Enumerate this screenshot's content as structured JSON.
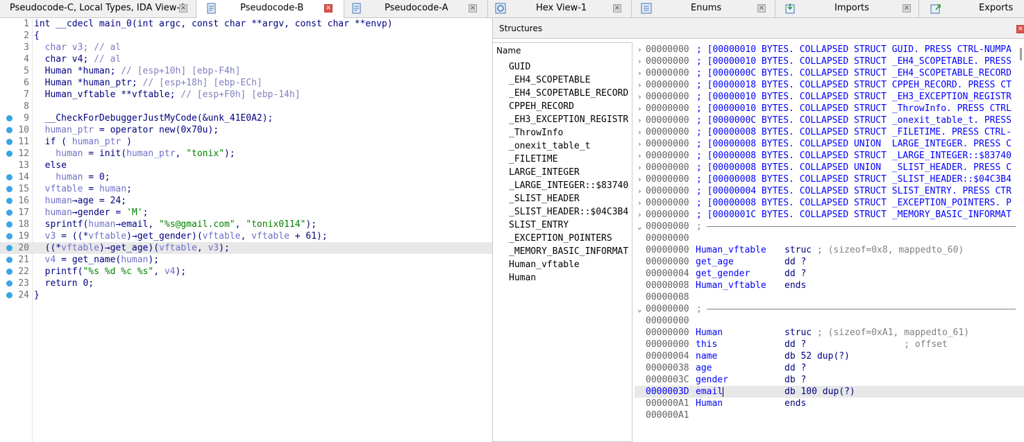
{
  "tabs": [
    {
      "label": "Pseudocode-C, Local Types, IDA View-A",
      "active": false,
      "close": "×"
    },
    {
      "label": "Pseudocode-B",
      "active": true,
      "close": "×"
    },
    {
      "label": "Pseudocode-A",
      "active": false,
      "close": "×"
    },
    {
      "label": "Hex View-1",
      "active": false,
      "close": "×"
    },
    {
      "label": "Enums",
      "active": false,
      "close": "×"
    },
    {
      "label": "Imports",
      "active": false,
      "close": "×"
    },
    {
      "label": "Exports",
      "active": false,
      "close": ""
    }
  ],
  "code": {
    "highlight_line": 20,
    "lines": [
      {
        "n": "1",
        "bp": false,
        "tokens": [
          [
            "p",
            "int __cdecl main_0(int argc, const char **argv, const char **envp)"
          ]
        ]
      },
      {
        "n": "2",
        "bp": false,
        "tokens": [
          [
            "p",
            "{"
          ]
        ]
      },
      {
        "n": "3",
        "bp": false,
        "tokens": [
          [
            "v",
            "  char v3; "
          ],
          [
            "c",
            "// al"
          ]
        ]
      },
      {
        "n": "4",
        "bp": false,
        "tokens": [
          [
            "p",
            "  char v4; "
          ],
          [
            "c",
            "// al"
          ]
        ]
      },
      {
        "n": "5",
        "bp": false,
        "tokens": [
          [
            "p",
            "  Human *human; "
          ],
          [
            "c",
            "// [esp+10h] [ebp-F4h]"
          ]
        ]
      },
      {
        "n": "6",
        "bp": false,
        "tokens": [
          [
            "p",
            "  Human *human_ptr; "
          ],
          [
            "c",
            "// [esp+18h] [ebp-ECh]"
          ]
        ]
      },
      {
        "n": "7",
        "bp": false,
        "tokens": [
          [
            "p",
            "  Human_vftable **vftable; "
          ],
          [
            "c",
            "// [esp+F0h] [ebp-14h]"
          ]
        ]
      },
      {
        "n": "8",
        "bp": false,
        "tokens": [
          [
            "p",
            ""
          ]
        ]
      },
      {
        "n": "9",
        "bp": true,
        "tokens": [
          [
            "p",
            "  __CheckForDebuggerJustMyCode(&unk_41E0A2);"
          ]
        ]
      },
      {
        "n": "10",
        "bp": true,
        "tokens": [
          [
            "v",
            "  human_ptr"
          ],
          [
            "p",
            " = operator new(0x70u);"
          ]
        ]
      },
      {
        "n": "11",
        "bp": true,
        "tokens": [
          [
            "p",
            "  if ( "
          ],
          [
            "v",
            "human_ptr"
          ],
          [
            "p",
            " )"
          ]
        ]
      },
      {
        "n": "12",
        "bp": true,
        "tokens": [
          [
            "v",
            "    human"
          ],
          [
            "p",
            " = init("
          ],
          [
            "v",
            "human_ptr"
          ],
          [
            "p",
            ", "
          ],
          [
            "s",
            "\"tonix\""
          ],
          [
            "p",
            ");"
          ]
        ]
      },
      {
        "n": "13",
        "bp": false,
        "tokens": [
          [
            "p",
            "  else"
          ]
        ]
      },
      {
        "n": "14",
        "bp": true,
        "tokens": [
          [
            "v",
            "    human"
          ],
          [
            "p",
            " = 0;"
          ]
        ]
      },
      {
        "n": "15",
        "bp": true,
        "tokens": [
          [
            "v",
            "  vftable"
          ],
          [
            "p",
            " = "
          ],
          [
            "v",
            "human"
          ],
          [
            "p",
            ";"
          ]
        ]
      },
      {
        "n": "16",
        "bp": true,
        "tokens": [
          [
            "v",
            "  human"
          ],
          [
            "p",
            "→age = 24;"
          ]
        ]
      },
      {
        "n": "17",
        "bp": true,
        "tokens": [
          [
            "v",
            "  human"
          ],
          [
            "p",
            "→gender = "
          ],
          [
            "s",
            "'M'"
          ],
          [
            "p",
            ";"
          ]
        ]
      },
      {
        "n": "18",
        "bp": true,
        "tokens": [
          [
            "p",
            "  sprintf("
          ],
          [
            "v",
            "human"
          ],
          [
            "p",
            "→email, "
          ],
          [
            "s",
            "\"%s@gmail.com\""
          ],
          [
            "p",
            ", "
          ],
          [
            "s",
            "\"tonix0114\""
          ],
          [
            "p",
            ");"
          ]
        ]
      },
      {
        "n": "19",
        "bp": true,
        "tokens": [
          [
            "v",
            "  v3"
          ],
          [
            "p",
            " = ((*"
          ],
          [
            "v",
            "vftable"
          ],
          [
            "p",
            ")→get_gender)("
          ],
          [
            "v",
            "vftable"
          ],
          [
            "p",
            ", "
          ],
          [
            "v",
            "vftable"
          ],
          [
            "p",
            " + 61);"
          ]
        ]
      },
      {
        "n": "20",
        "bp": true,
        "tokens": [
          [
            "p",
            "  ((*"
          ],
          [
            "v",
            "vftable"
          ],
          [
            "p",
            ")→get_age)("
          ],
          [
            "v",
            "vftable"
          ],
          [
            "p",
            ", "
          ],
          [
            "v",
            "v3"
          ],
          [
            "p",
            ");"
          ]
        ]
      },
      {
        "n": "21",
        "bp": true,
        "tokens": [
          [
            "v",
            "  v4"
          ],
          [
            "p",
            " = get_name("
          ],
          [
            "v",
            "human"
          ],
          [
            "p",
            ");"
          ]
        ]
      },
      {
        "n": "22",
        "bp": true,
        "tokens": [
          [
            "p",
            "  printf("
          ],
          [
            "s",
            "\"%s %d %c %s\""
          ],
          [
            "p",
            ", "
          ],
          [
            "v",
            "v4"
          ],
          [
            "p",
            ");"
          ]
        ]
      },
      {
        "n": "23",
        "bp": true,
        "tokens": [
          [
            "p",
            "  return 0;"
          ]
        ]
      },
      {
        "n": "24",
        "bp": true,
        "tokens": [
          [
            "p",
            "}"
          ]
        ]
      }
    ]
  },
  "structures": {
    "title": "Structures",
    "close": "×",
    "name_header": "Name",
    "names": [
      "GUID",
      "_EH4_SCOPETABLE",
      "_EH4_SCOPETABLE_RECORD",
      "CPPEH_RECORD",
      "_EH3_EXCEPTION_REGISTR",
      "_ThrowInfo",
      "_onexit_table_t",
      "_FILETIME",
      "LARGE_INTEGER",
      "_LARGE_INTEGER::$83740",
      "_SLIST_HEADER",
      "_SLIST_HEADER::$04C3B4",
      "SLIST_ENTRY",
      "_EXCEPTION_POINTERS",
      "_MEMORY_BASIC_INFORMAT",
      "Human_vftable",
      "Human"
    ],
    "collapsed": [
      {
        "addr": "00000000",
        "text": "; [00000010 BYTES. COLLAPSED STRUCT GUID. PRESS CTRL-NUMPA"
      },
      {
        "addr": "00000000",
        "text": "; [00000010 BYTES. COLLAPSED STRUCT _EH4_SCOPETABLE. PRESS"
      },
      {
        "addr": "00000000",
        "text": "; [0000000C BYTES. COLLAPSED STRUCT _EH4_SCOPETABLE_RECORD"
      },
      {
        "addr": "00000000",
        "text": "; [00000018 BYTES. COLLAPSED STRUCT CPPEH_RECORD. PRESS CT"
      },
      {
        "addr": "00000000",
        "text": "; [00000010 BYTES. COLLAPSED STRUCT _EH3_EXCEPTION_REGISTR"
      },
      {
        "addr": "00000000",
        "text": "; [00000010 BYTES. COLLAPSED STRUCT _ThrowInfo. PRESS CTRL"
      },
      {
        "addr": "00000000",
        "text": "; [0000000C BYTES. COLLAPSED STRUCT _onexit_table_t. PRESS"
      },
      {
        "addr": "00000000",
        "text": "; [00000008 BYTES. COLLAPSED STRUCT _FILETIME. PRESS CTRL-"
      },
      {
        "addr": "00000000",
        "text": "; [00000008 BYTES. COLLAPSED UNION  LARGE_INTEGER. PRESS C"
      },
      {
        "addr": "00000000",
        "text": "; [00000008 BYTES. COLLAPSED STRUCT _LARGE_INTEGER::$83740"
      },
      {
        "addr": "00000000",
        "text": "; [00000008 BYTES. COLLAPSED UNION  _SLIST_HEADER. PRESS C"
      },
      {
        "addr": "00000000",
        "text": "; [00000008 BYTES. COLLAPSED STRUCT _SLIST_HEADER::$04C3B4"
      },
      {
        "addr": "00000000",
        "text": "; [00000004 BYTES. COLLAPSED STRUCT SLIST_ENTRY. PRESS CTR"
      },
      {
        "addr": "00000000",
        "text": "; [00000008 BYTES. COLLAPSED STRUCT _EXCEPTION_POINTERS. P"
      },
      {
        "addr": "00000000",
        "text": "; [0000001C BYTES. COLLAPSED STRUCT _MEMORY_BASIC_INFORMAT"
      }
    ],
    "vftable_block": {
      "sep_addr": "00000000",
      "sep_semi": ";",
      "blank_addr": "00000000",
      "rows": [
        {
          "addr": "00000000",
          "field": "Human_vftable",
          "decl": "struc",
          "comment": "; (sizeof=0x8, mappedto_60)"
        },
        {
          "addr": "00000000",
          "field": "get_age",
          "decl": "dd ?",
          "comment": ""
        },
        {
          "addr": "00000004",
          "field": "get_gender",
          "decl": "dd ?",
          "comment": ""
        },
        {
          "addr": "00000008",
          "field": "Human_vftable",
          "decl": "ends",
          "comment": ""
        }
      ],
      "tail_addr": "00000008"
    },
    "human_block": {
      "sep_addr": "00000000",
      "sep_semi": ";",
      "blank_addr": "00000000",
      "rows": [
        {
          "addr": "00000000",
          "field": "Human",
          "decl": "struc",
          "comment": "; (sizeof=0xA1, mappedto_61)",
          "hl": false
        },
        {
          "addr": "00000000",
          "field": "this",
          "decl": "dd ?",
          "comment": "                 ; offset",
          "hl": false
        },
        {
          "addr": "00000004",
          "field": "name",
          "decl": "db 52 dup(?)",
          "comment": "",
          "hl": false
        },
        {
          "addr": "00000038",
          "field": "age",
          "decl": "dd ?",
          "comment": "",
          "hl": false
        },
        {
          "addr": "0000003C",
          "field": "gender",
          "decl": "db ?",
          "comment": "",
          "hl": false
        },
        {
          "addr": "0000003D",
          "field": "email",
          "decl": "db 100 dup(?)",
          "comment": "",
          "hl": true
        },
        {
          "addr": "000000A1",
          "field": "Human",
          "decl": "ends",
          "comment": "",
          "hl": false
        }
      ],
      "tail_addr": "000000A1"
    }
  },
  "colors": {
    "accent": "#3aa5e4",
    "code_blue": "#000080",
    "var": "#7070c8",
    "string": "#008000",
    "struct_blue": "#0000ff",
    "close_red": "#e0504a"
  }
}
